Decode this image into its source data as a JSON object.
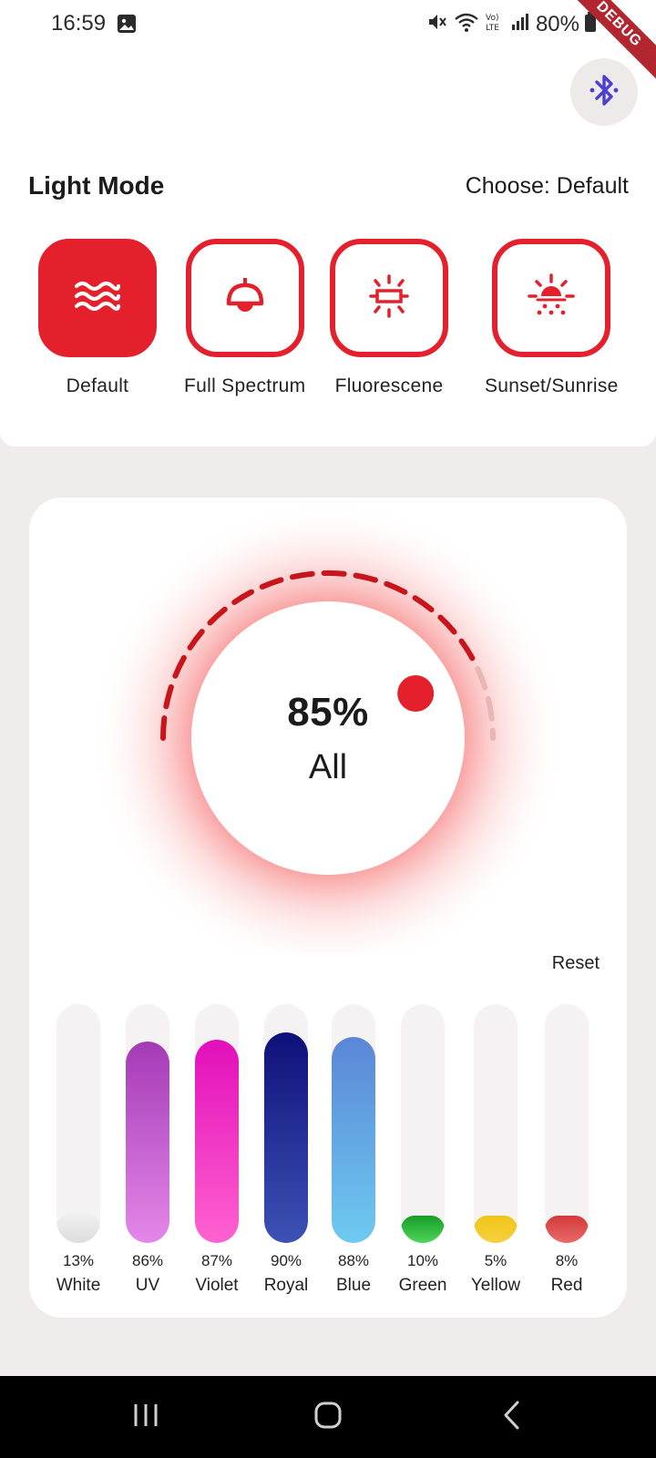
{
  "status": {
    "time": "16:59",
    "battery": "80%",
    "icons": [
      "gallery-icon",
      "mute-icon",
      "wifi-icon",
      "volte-icon",
      "signal-icon",
      "battery-icon"
    ]
  },
  "debug_banner": "DEBUG",
  "header": {
    "title": "Light Mode",
    "choose": "Choose: Default"
  },
  "modes": [
    {
      "label": "Default",
      "icon": "waves-icon",
      "active": true
    },
    {
      "label": "Full Spectrum",
      "icon": "pendant-lamp-icon",
      "active": false
    },
    {
      "label": "Fluorescene",
      "icon": "tube-light-icon",
      "active": false
    },
    {
      "label": "Sunset/Sunrise",
      "icon": "sunrise-icon",
      "active": false
    }
  ],
  "dial": {
    "value": "85%",
    "label": "All",
    "level": 0.85
  },
  "reset_label": "Reset",
  "channels": [
    {
      "name": "White",
      "percent": "13%",
      "level": 0.13,
      "colors": [
        "#f1f1f1",
        "#dddddd"
      ]
    },
    {
      "name": "UV",
      "percent": "86%",
      "level": 0.86,
      "colors": [
        "#a43bb5",
        "#e487e9"
      ]
    },
    {
      "name": "Violet",
      "percent": "87%",
      "level": 0.87,
      "colors": [
        "#e20fba",
        "#ff62d0"
      ]
    },
    {
      "name": "Royal",
      "percent": "90%",
      "level": 0.9,
      "colors": [
        "#0e1078",
        "#3d52b5"
      ]
    },
    {
      "name": "Blue",
      "percent": "88%",
      "level": 0.88,
      "colors": [
        "#5a86d6",
        "#6ecaf0"
      ]
    },
    {
      "name": "Green",
      "percent": "10%",
      "level": 0.1,
      "colors": [
        "#189d25",
        "#4ed45c"
      ]
    },
    {
      "name": "Yellow",
      "percent": "5%",
      "level": 0.05,
      "colors": [
        "#f0c418",
        "#f6d13f"
      ]
    },
    {
      "name": "Red",
      "percent": "8%",
      "level": 0.08,
      "colors": [
        "#d33a3a",
        "#e86a6a"
      ]
    }
  ],
  "accent": "#e3202b"
}
